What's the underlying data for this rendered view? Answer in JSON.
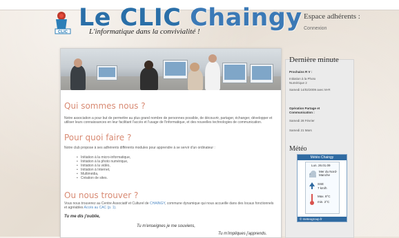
{
  "header": {
    "title_prefix": "Le CLIC ",
    "title_brand": "Chaingy",
    "tagline": "L'informatique dans la convivialité !",
    "espace_label": "Espace adhérents :",
    "connect_link": "Connexion",
    "logo_text": "CLIC"
  },
  "main": {
    "section1": {
      "title": "Qui sommes nous ?",
      "text": "Notre association a pour but de permettre au plus grand nombre de personnes possible, de découvrir, partager, échanger, développer et utiliser leurs connaissances en leur facilitant l'accès et l'usage de l'informatique, et des nouvelles technologies de communication."
    },
    "section2": {
      "title": "Pour quoi faire ?",
      "intro": "Notre club propose à ses adhérents différents modules pour apprendre à se servir d'un ordinateur :",
      "items": [
        "Initiation à la micro-informatique,",
        "Initiation à la photo numérique,",
        "Initiation à la vidéo,",
        "Initiation à Internet,",
        "Multimédia,",
        "Création de sites."
      ]
    },
    "section3": {
      "title": "Ou nous trouver ?",
      "text_before_link1": "Vous nous trouverez au Centre Associatif et Culturel de ",
      "link1": "CHAINGY",
      "text_after_link1": ", commune dynamique qui nous accueille dans des locaux fonctionnels et agréables ",
      "link2": "Accès au CAC (p. 1)",
      "text_end": ".",
      "quote_line1": "Tu me dis j'oublie,",
      "quote_line2": "Tu m'enseignes je me souviens,",
      "quote_line3": "Tu m'impliques j'apprends."
    }
  },
  "sidebar": {
    "section_title": "Dernière minute",
    "prochains_title": "Prochains R V :",
    "prochains_line1": "Initiation à la Photo",
    "prochains_line2": "Numérique 2",
    "prochains_date": "Samedi 14/02/2009 avec M-R",
    "operation_title_line1": "Opération Partage et",
    "operation_title_line2": "Communication :",
    "operation_date1": "Samedi 28 Février",
    "operation_date2": "Samedi 21 Mars",
    "meteo_title": "Météo",
    "meteo_widget": {
      "header": "Météo Chaingy",
      "date": "Lun. 26.01.09",
      "line1": "Mer du Nord-",
      "line2": "Manche",
      "wind_dir": "SSE",
      "wind_speed": "7 km/h",
      "max": "Max.    8°C",
      "min": "min.    2°C",
      "footer": "© meteogroup.fr"
    }
  }
}
